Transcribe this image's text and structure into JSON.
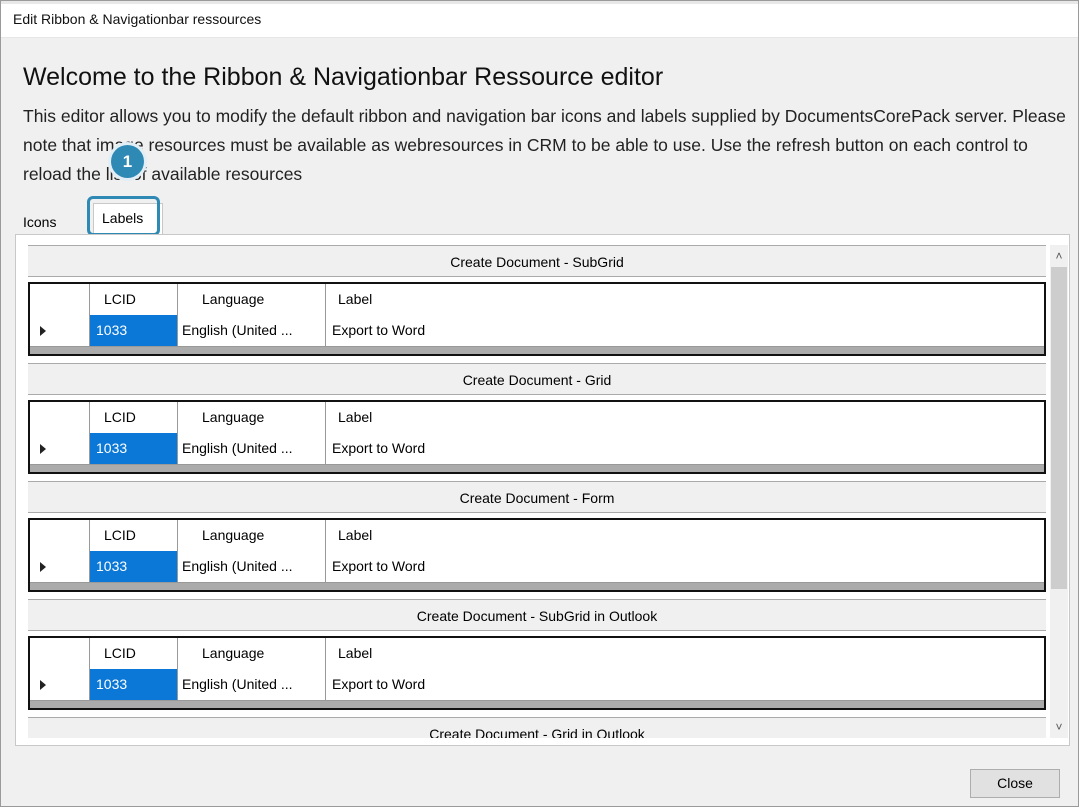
{
  "window": {
    "title": "Edit Ribbon & Navigationbar ressources"
  },
  "header": {
    "heading": "Welcome to the Ribbon & Navigationbar Ressource editor",
    "description": "This editor allows you to modify the default ribbon and navigation bar icons and labels supplied by DocumentsCorePack server. Please note that image resources must be available as webresources in CRM to be able to use. Use the refresh button on each control to reload the list of available resources"
  },
  "tabs": [
    {
      "label": "Icons"
    },
    {
      "label": "Labels",
      "selected": true
    }
  ],
  "callout": {
    "number": "1"
  },
  "columns": {
    "lcid": "LCID",
    "language": "Language",
    "label": "Label"
  },
  "sections": [
    {
      "title": "Create Document - SubGrid",
      "row": {
        "lcid": "1033",
        "language": "English (United ...",
        "label": "Export to Word"
      }
    },
    {
      "title": "Create Document - Grid",
      "row": {
        "lcid": "1033",
        "language": "English (United ...",
        "label": "Export to Word"
      }
    },
    {
      "title": "Create Document - Form",
      "row": {
        "lcid": "1033",
        "language": "English (United ...",
        "label": "Export to Word"
      }
    },
    {
      "title": "Create Document - SubGrid in Outlook",
      "row": {
        "lcid": "1033",
        "language": "English (United ...",
        "label": "Export to Word"
      }
    },
    {
      "title": "Create Document - Grid in Outlook"
    }
  ],
  "scrollbar": {
    "up_icon": "chevron-up-icon",
    "down_icon": "chevron-down-icon"
  },
  "footer": {
    "close_label": "Close"
  },
  "colors": {
    "accent": "#2f89b5",
    "selection": "#0b77d6"
  }
}
